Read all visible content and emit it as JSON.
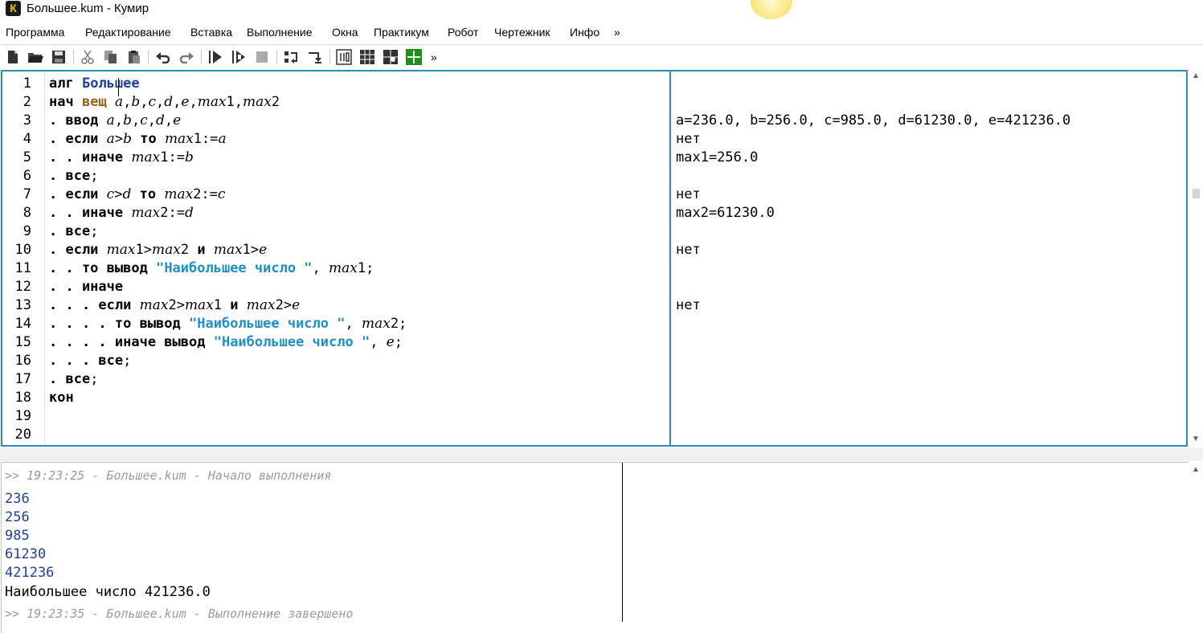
{
  "window": {
    "title": "Большее.kum - Кумир",
    "logo_letter": "К"
  },
  "menu": {
    "items": [
      "Программа",
      "Редактирование",
      "Вставка",
      "Выполнение",
      "Окна",
      "Практикум",
      "Робот",
      "Чертежник",
      "Инфо"
    ],
    "overflow": "»"
  },
  "toolbar": {
    "icons": [
      "new-file-icon",
      "open-folder-icon",
      "save-icon",
      "cut-icon",
      "copy-icon",
      "paste-icon",
      "undo-icon",
      "redo-icon",
      "run-icon",
      "run-step-icon",
      "stop-icon",
      "step-into-icon",
      "step-out-icon",
      "variables-icon",
      "grid-icon",
      "robot-icon",
      "drawer-icon"
    ],
    "overflow": "»"
  },
  "editor": {
    "line_numbers": [
      "1",
      "2",
      "3",
      "4",
      "5",
      "6",
      "7",
      "8",
      "9",
      "10",
      "11",
      "12",
      "13",
      "14",
      "15",
      "16",
      "17",
      "18",
      "19",
      "20"
    ],
    "lines": [
      [
        [
          "kw",
          "алг"
        ],
        [
          "",
          "",
          " "
        ],
        [
          "nm",
          "Большее"
        ]
      ],
      [
        [
          "kw",
          "нач"
        ],
        [
          "",
          " "
        ],
        [
          "tp",
          "вещ"
        ],
        [
          "",
          " "
        ],
        [
          "vr",
          "a"
        ],
        [
          "",
          ","
        ],
        [
          "vr",
          "b"
        ],
        [
          "",
          ","
        ],
        [
          "vr",
          "c"
        ],
        [
          "",
          ","
        ],
        [
          "vr",
          "d"
        ],
        [
          "",
          ","
        ],
        [
          "vr",
          "e"
        ],
        [
          "",
          ","
        ],
        [
          "vr",
          "max"
        ],
        [
          "",
          "1,"
        ],
        [
          "vr",
          "max"
        ],
        [
          "",
          "2"
        ]
      ],
      [
        [
          "kw",
          ". ввод"
        ],
        [
          "",
          " "
        ],
        [
          "vr",
          "a"
        ],
        [
          "",
          ","
        ],
        [
          "vr",
          "b"
        ],
        [
          "",
          ","
        ],
        [
          "vr",
          "c"
        ],
        [
          "",
          ","
        ],
        [
          "vr",
          "d"
        ],
        [
          "",
          ","
        ],
        [
          "vr",
          "e"
        ]
      ],
      [
        [
          "kw",
          ". если"
        ],
        [
          "",
          " "
        ],
        [
          "vr",
          "a"
        ],
        [
          "",
          ">"
        ],
        [
          "vr",
          "b"
        ],
        [
          "",
          " "
        ],
        [
          "kw",
          "то"
        ],
        [
          "",
          " "
        ],
        [
          "vr",
          "max"
        ],
        [
          "",
          "1:="
        ],
        [
          "vr",
          "a"
        ]
      ],
      [
        [
          "kw",
          ". . иначе"
        ],
        [
          "",
          " "
        ],
        [
          "vr",
          "max"
        ],
        [
          "",
          "1:="
        ],
        [
          "vr",
          "b"
        ]
      ],
      [
        [
          "kw",
          ". все"
        ],
        [
          "",
          ";"
        ]
      ],
      [
        [
          "kw",
          ". если"
        ],
        [
          "",
          " "
        ],
        [
          "vr",
          "c"
        ],
        [
          "",
          ">"
        ],
        [
          "vr",
          "d"
        ],
        [
          "",
          " "
        ],
        [
          "kw",
          "то"
        ],
        [
          "",
          " "
        ],
        [
          "vr",
          "max"
        ],
        [
          "",
          "2:="
        ],
        [
          "vr",
          "c"
        ]
      ],
      [
        [
          "kw",
          ". . иначе"
        ],
        [
          "",
          " "
        ],
        [
          "vr",
          "max"
        ],
        [
          "",
          "2:="
        ],
        [
          "vr",
          "d"
        ]
      ],
      [
        [
          "kw",
          ". все"
        ],
        [
          "",
          ";"
        ]
      ],
      [
        [
          "kw",
          ". если"
        ],
        [
          "",
          " "
        ],
        [
          "vr",
          "max"
        ],
        [
          "",
          "1>"
        ],
        [
          "vr",
          "max"
        ],
        [
          "",
          "2 "
        ],
        [
          "kw",
          "и"
        ],
        [
          "",
          " "
        ],
        [
          "vr",
          "max"
        ],
        [
          "",
          "1>"
        ],
        [
          "vr",
          "e"
        ]
      ],
      [
        [
          "kw",
          ". . то вывод"
        ],
        [
          "",
          " "
        ],
        [
          "st",
          "\"Наибольшее число \""
        ],
        [
          "",
          ", "
        ],
        [
          "vr",
          "max"
        ],
        [
          "",
          "1;"
        ]
      ],
      [
        [
          "kw",
          ". . иначе"
        ]
      ],
      [
        [
          "kw",
          ". . . если"
        ],
        [
          "",
          " "
        ],
        [
          "vr",
          "max"
        ],
        [
          "",
          "2>"
        ],
        [
          "vr",
          "max"
        ],
        [
          "",
          "1 "
        ],
        [
          "kw",
          "и"
        ],
        [
          "",
          " "
        ],
        [
          "vr",
          "max"
        ],
        [
          "",
          "2>"
        ],
        [
          "vr",
          "e"
        ]
      ],
      [
        [
          "kw",
          ". . . . то вывод"
        ],
        [
          "",
          " "
        ],
        [
          "st",
          "\"Наибольшее число \""
        ],
        [
          "",
          ", "
        ],
        [
          "vr",
          "max"
        ],
        [
          "",
          "2;"
        ]
      ],
      [
        [
          "kw",
          ". . . . иначе вывод"
        ],
        [
          "",
          " "
        ],
        [
          "st",
          "\"Наибольшее число \""
        ],
        [
          "",
          ", "
        ],
        [
          "vr",
          "e"
        ],
        [
          "",
          ";"
        ]
      ],
      [
        [
          "kw",
          ". . . все"
        ],
        [
          "",
          ";"
        ]
      ],
      [
        [
          "kw",
          ". все"
        ],
        [
          "",
          ";"
        ]
      ],
      [
        [
          "kw",
          "кон"
        ]
      ],
      [],
      []
    ],
    "margin_lines": [
      "",
      "",
      "a=236.0, b=256.0, c=985.0, d=61230.0, e=421236.0",
      "нет",
      "max1=256.0",
      "",
      "нет",
      "max2=61230.0",
      "",
      "нет",
      "",
      "",
      "нет",
      "",
      "",
      "",
      "",
      "",
      "",
      ""
    ]
  },
  "console": {
    "start": ">> 19:23:25 - Большее.kum - Начало выполнения",
    "inputs": [
      "236",
      "256",
      "985",
      "61230",
      "421236"
    ],
    "output": "Наибольшее число 421236.0",
    "end": ">> 19:23:35 - Большее.kum - Выполнение завершено"
  }
}
